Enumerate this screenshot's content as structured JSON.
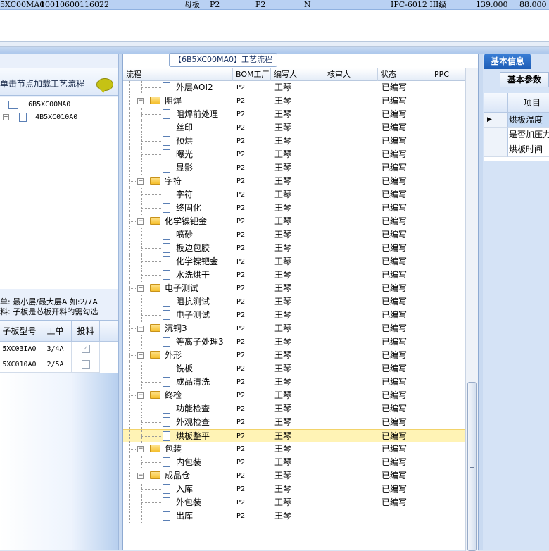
{
  "top_row": {
    "code": "5XC00MA0",
    "number": "10010600116022",
    "board_type": "母板",
    "factory1": "P2",
    "factory2": "P2",
    "flag": "N",
    "material": "IPC-6012 III级",
    "value1": "139.000",
    "value2": "88.000"
  },
  "left_panel": {
    "header": "单击节点加载工艺流程",
    "tree": [
      {
        "label": "6B5XC00MA0"
      },
      {
        "label": "4B5XC010A0"
      }
    ],
    "notes": [
      "单: 最小层/最大层A 如:2/7A",
      "料: 子板是芯板开料的需勾选"
    ],
    "table": {
      "columns": [
        "子板型号",
        "工单",
        "投料"
      ],
      "rows": [
        {
          "model": "5XC03IA0",
          "order": "3/4A",
          "checked": true
        },
        {
          "model": "5XC010A0",
          "order": "2/5A",
          "checked": false
        }
      ]
    }
  },
  "center": {
    "title": "【6B5XC00MA0】工艺流程",
    "columns": [
      "流程",
      "BOM工厂",
      "编写人",
      "核审人",
      "状态",
      "PPC"
    ],
    "rows": [
      {
        "name": "外层AOI2",
        "type": "item",
        "bom": "P2",
        "author": "王琴",
        "status": "已编写"
      },
      {
        "name": "阻焊",
        "type": "group",
        "bom": "P2",
        "author": "王琴",
        "status": "已编写"
      },
      {
        "name": "阻焊前处理",
        "type": "item",
        "bom": "P2",
        "author": "王琴",
        "status": "已编写"
      },
      {
        "name": "丝印",
        "type": "item",
        "bom": "P2",
        "author": "王琴",
        "status": "已编写"
      },
      {
        "name": "预烘",
        "type": "item",
        "bom": "P2",
        "author": "王琴",
        "status": "已编写"
      },
      {
        "name": "曝光",
        "type": "item",
        "bom": "P2",
        "author": "王琴",
        "status": "已编写"
      },
      {
        "name": "显影",
        "type": "item",
        "bom": "P2",
        "author": "王琴",
        "status": "已编写"
      },
      {
        "name": "字符",
        "type": "group",
        "bom": "P2",
        "author": "王琴",
        "status": "已编写"
      },
      {
        "name": "字符",
        "type": "item",
        "bom": "P2",
        "author": "王琴",
        "status": "已编写"
      },
      {
        "name": "终固化",
        "type": "item",
        "bom": "P2",
        "author": "王琴",
        "status": "已编写"
      },
      {
        "name": "化学镍钯金",
        "type": "group",
        "bom": "P2",
        "author": "王琴",
        "status": "已编写"
      },
      {
        "name": "喷砂",
        "type": "item",
        "bom": "P2",
        "author": "王琴",
        "status": "已编写"
      },
      {
        "name": "板边包胶",
        "type": "item",
        "bom": "P2",
        "author": "王琴",
        "status": "已编写"
      },
      {
        "name": "化学镍钯金",
        "type": "item",
        "bom": "P2",
        "author": "王琴",
        "status": "已编写"
      },
      {
        "name": "水洗烘干",
        "type": "item",
        "bom": "P2",
        "author": "王琴",
        "status": "已编写"
      },
      {
        "name": "电子测试",
        "type": "group",
        "bom": "P2",
        "author": "王琴",
        "status": "已编写"
      },
      {
        "name": "阻抗测试",
        "type": "item",
        "bom": "P2",
        "author": "王琴",
        "status": "已编写"
      },
      {
        "name": "电子测试",
        "type": "item",
        "bom": "P2",
        "author": "王琴",
        "status": "已编写"
      },
      {
        "name": "沉铜3",
        "type": "group",
        "bom": "P2",
        "author": "王琴",
        "status": "已编写"
      },
      {
        "name": "等离子处理3",
        "type": "item",
        "bom": "P2",
        "author": "王琴",
        "status": "已编写"
      },
      {
        "name": "外形",
        "type": "group",
        "bom": "P2",
        "author": "王琴",
        "status": "已编写"
      },
      {
        "name": "铣板",
        "type": "item",
        "bom": "P2",
        "author": "王琴",
        "status": "已编写"
      },
      {
        "name": "成品清洗",
        "type": "item",
        "bom": "P2",
        "author": "王琴",
        "status": "已编写"
      },
      {
        "name": "终检",
        "type": "group",
        "bom": "P2",
        "author": "王琴",
        "status": "已编写"
      },
      {
        "name": "功能检查",
        "type": "item",
        "bom": "P2",
        "author": "王琴",
        "status": "已编写"
      },
      {
        "name": "外观检查",
        "type": "item",
        "bom": "P2",
        "author": "王琴",
        "status": "已编写"
      },
      {
        "name": "烘板整平",
        "type": "item",
        "bom": "P2",
        "author": "王琴",
        "status": "已编写",
        "selected": true
      },
      {
        "name": "包装",
        "type": "group",
        "bom": "P2",
        "author": "王琴",
        "status": "已编写"
      },
      {
        "name": "内包装",
        "type": "item",
        "bom": "P2",
        "author": "王琴",
        "status": "已编写"
      },
      {
        "name": "成品仓",
        "type": "group",
        "bom": "P2",
        "author": "王琴",
        "status": "已编写"
      },
      {
        "name": "入库",
        "type": "item",
        "bom": "P2",
        "author": "王琴",
        "status": "已编写"
      },
      {
        "name": "外包装",
        "type": "item",
        "bom": "P2",
        "author": "王琴",
        "status": "已编写"
      },
      {
        "name": "出库",
        "type": "item",
        "bom": "P2",
        "author": "王琴",
        "status": ""
      }
    ]
  },
  "right_panel": {
    "tab": "基本信息",
    "subtab": "基本参数",
    "grid_header": "项目",
    "items": [
      "烘板温度",
      "是否加压力",
      "烘板时间"
    ]
  },
  "colors": {
    "selected_row": "#fff3b5",
    "accent": "#1e5db6",
    "folder": "#f5bf2c"
  }
}
